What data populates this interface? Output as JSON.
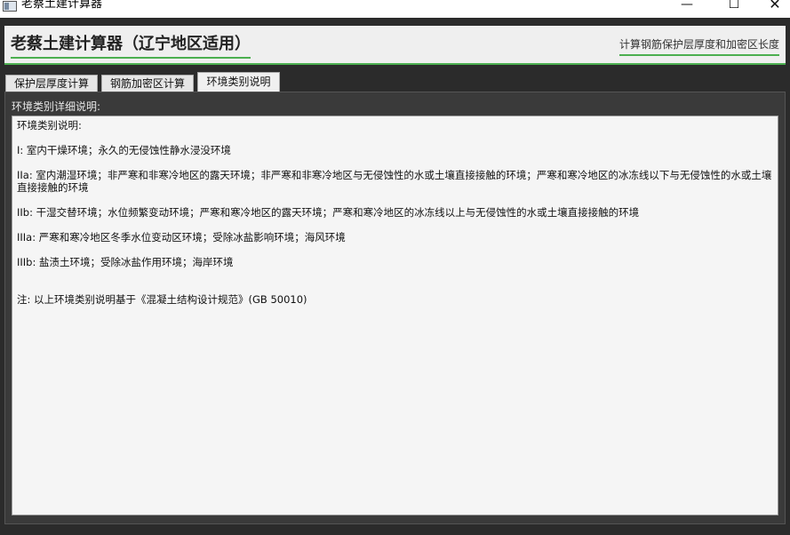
{
  "window": {
    "title": "老蔡土建计算器",
    "min_glyph": "—",
    "max_glyph": "☐",
    "close_glyph": "✕"
  },
  "header": {
    "title": "老蔡土建计算器（辽宁地区适用）",
    "subtitle": "计算钢筋保护层厚度和加密区长度",
    "accent_color": "#4caf50"
  },
  "tabs": [
    {
      "label": "保护层厚度计算",
      "active": false
    },
    {
      "label": "钢筋加密区计算",
      "active": false
    },
    {
      "label": "环境类别说明",
      "active": true
    }
  ],
  "panel": {
    "label": "环境类别详细说明:",
    "lines": [
      "环境类别说明:",
      "I: 室内干燥环境；永久的无侵蚀性静水浸没环境",
      "IIa: 室内潮湿环境；非严寒和非寒冷地区的露天环境；非严寒和非寒冷地区与无侵蚀性的水或土壤直接接触的环境；严寒和寒冷地区的冰冻线以下与无侵蚀性的水或土壤直接接触的环境",
      "IIb: 干湿交替环境；水位频繁变动环境；严寒和寒冷地区的露天环境；严寒和寒冷地区的冰冻线以上与无侵蚀性的水或土壤直接接触的环境",
      "IIIa: 严寒和寒冷地区冬季水位变动区环境；受除冰盐影响环境；海风环境",
      "IIIb: 盐渍土环境；受除冰盐作用环境；海岸环境",
      "注: 以上环境类别说明基于《混凝土结构设计规范》(GB 50010)"
    ]
  }
}
